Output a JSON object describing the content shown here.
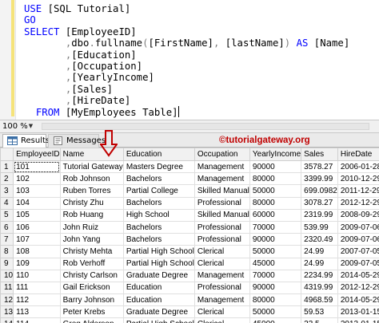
{
  "editor": {
    "lines": [
      [
        {
          "t": "USE",
          "c": "kw"
        },
        {
          "t": " [SQL Tutorial]",
          "c": ""
        }
      ],
      [
        {
          "t": "GO",
          "c": "kw"
        }
      ],
      [
        {
          "t": "SELECT",
          "c": "kw"
        },
        {
          "t": " [EmployeeID]",
          "c": ""
        }
      ],
      [
        {
          "t": "       ",
          "c": ""
        },
        {
          "t": ",",
          "c": "gr"
        },
        {
          "t": "dbo",
          "c": ""
        },
        {
          "t": ".",
          "c": "gr"
        },
        {
          "t": "fullname",
          "c": ""
        },
        {
          "t": "(",
          "c": "gr"
        },
        {
          "t": "[FirstName]",
          "c": ""
        },
        {
          "t": ",",
          "c": "gr"
        },
        {
          "t": " [lastName]",
          "c": ""
        },
        {
          "t": ")",
          "c": "gr"
        },
        {
          "t": " ",
          "c": ""
        },
        {
          "t": "AS",
          "c": "kw"
        },
        {
          "t": " [Name]",
          "c": ""
        }
      ],
      [
        {
          "t": "       ",
          "c": ""
        },
        {
          "t": ",",
          "c": "gr"
        },
        {
          "t": "[Education]",
          "c": ""
        }
      ],
      [
        {
          "t": "       ",
          "c": ""
        },
        {
          "t": ",",
          "c": "gr"
        },
        {
          "t": "[Occupation]",
          "c": ""
        }
      ],
      [
        {
          "t": "       ",
          "c": ""
        },
        {
          "t": ",",
          "c": "gr"
        },
        {
          "t": "[YearlyIncome]",
          "c": ""
        }
      ],
      [
        {
          "t": "       ",
          "c": ""
        },
        {
          "t": ",",
          "c": "gr"
        },
        {
          "t": "[Sales]",
          "c": ""
        }
      ],
      [
        {
          "t": "       ",
          "c": ""
        },
        {
          "t": ",",
          "c": "gr"
        },
        {
          "t": "[HireDate]",
          "c": ""
        }
      ],
      [
        {
          "t": "  ",
          "c": ""
        },
        {
          "t": "FROM",
          "c": "kw"
        },
        {
          "t": " [MyEmployees Table]",
          "c": ""
        }
      ]
    ]
  },
  "zoom": {
    "level": "100 %",
    "dropdown_glyph": "▼"
  },
  "tabs": {
    "results_label": "Results",
    "messages_label": "Messages"
  },
  "watermark": "©tutorialgateway.org",
  "grid": {
    "columns": [
      "EmployeeID",
      "Name",
      "Education",
      "Occupation",
      "YearlyIncome",
      "Sales",
      "HireDate"
    ],
    "rows": [
      [
        "1",
        "101",
        "Tutorial  Gateway",
        "Masters Degree",
        "Management",
        "90000",
        "3578.27",
        "2006-01-28"
      ],
      [
        "2",
        "102",
        "Rob  Johnson",
        "Bachelors",
        "Management",
        "80000",
        "3399.99",
        "2010-12-29"
      ],
      [
        "3",
        "103",
        "Ruben  Torres",
        "Partial College",
        "Skilled Manual",
        "50000",
        "699.0982",
        "2011-12-29"
      ],
      [
        "4",
        "104",
        "Christy  Zhu",
        "Bachelors",
        "Professional",
        "80000",
        "3078.27",
        "2012-12-29"
      ],
      [
        "5",
        "105",
        "Rob  Huang",
        "High School",
        "Skilled Manual",
        "60000",
        "2319.99",
        "2008-09-29"
      ],
      [
        "6",
        "106",
        "John  Ruiz",
        "Bachelors",
        "Professional",
        "70000",
        "539.99",
        "2009-07-06"
      ],
      [
        "7",
        "107",
        "John  Yang",
        "Bachelors",
        "Professional",
        "90000",
        "2320.49",
        "2009-07-06"
      ],
      [
        "8",
        "108",
        "Christy  Mehta",
        "Partial High School",
        "Clerical",
        "50000",
        "24.99",
        "2007-07-05"
      ],
      [
        "9",
        "109",
        "Rob  Verhoff",
        "Partial High School",
        "Clerical",
        "45000",
        "24.99",
        "2009-07-05"
      ],
      [
        "10",
        "110",
        "Christy  Carlson",
        "Graduate Degree",
        "Management",
        "70000",
        "2234.99",
        "2014-05-29"
      ],
      [
        "11",
        "111",
        "Gail  Erickson",
        "Education",
        "Professional",
        "90000",
        "4319.99",
        "2012-12-29"
      ],
      [
        "12",
        "112",
        "Barry  Johnson",
        "Education",
        "Management",
        "80000",
        "4968.59",
        "2014-05-29"
      ],
      [
        "13",
        "113",
        "Peter  Krebs",
        "Graduate Degree",
        "Clerical",
        "50000",
        "59.53",
        "2013-01-15"
      ],
      [
        "14",
        "114",
        "Greg  Alderson",
        "Partial High School",
        "Clerical",
        "45000",
        "23.5",
        "2013-01-15"
      ]
    ]
  },
  "colors": {
    "keyword": "#0000ff",
    "function": "#ff00ff",
    "watermark": "#c00000",
    "change_bar": "#f5e37a"
  },
  "icons": {
    "results_tab": "results-grid-icon",
    "messages_tab": "messages-icon",
    "arrow": "red-down-arrow-icon"
  }
}
